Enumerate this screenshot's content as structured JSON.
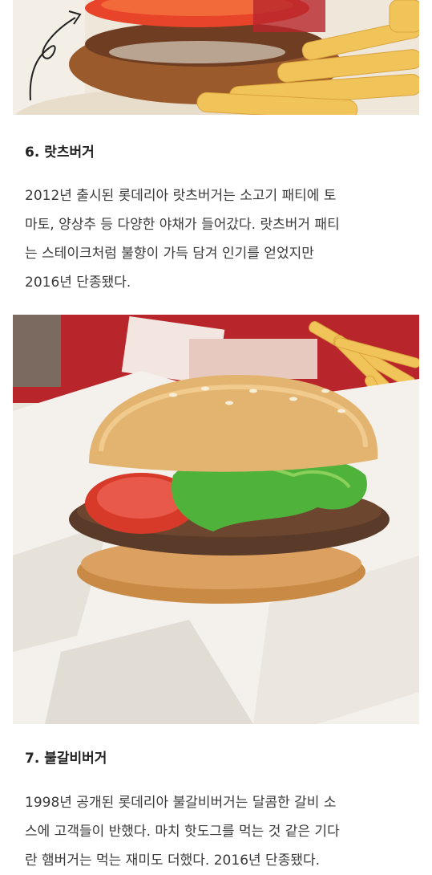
{
  "sections": [
    {
      "heading": "6. 랏츠버거",
      "lines": [
        "2012년 출시된 롯데리아 랏츠버거는 소고기 패티에 토",
        "마토, 양상추 등 다양한 야채가 들어갔다. 랏츠버거 패티",
        "는 스테이크처럼 불향이 가득 담겨 인기를 얻었지만",
        "2016년 단종됐다."
      ]
    },
    {
      "heading": "7. 불갈비버거",
      "lines": [
        "1998년 공개된 롯데리아 불갈비버거는 달콤한 갈비 소",
        "스에 고객들이 반했다. 마치 핫도그를 먹는 것 같은 기다",
        "란 햄버거는 먹는 재미도 더했다. 2016년 단종됐다."
      ]
    }
  ],
  "images": {
    "top": "burger-and-fries-photo",
    "middle": "ratz-burger-photo"
  },
  "colors": {
    "text": "#3a3a3a",
    "heading": "#222222",
    "bun": "#e3b470",
    "lettuce": "#4fb23a",
    "tomato": "#d83a2a",
    "patty": "#5a3a28",
    "fries": "#f1c45a",
    "tray": "#b8262c"
  }
}
